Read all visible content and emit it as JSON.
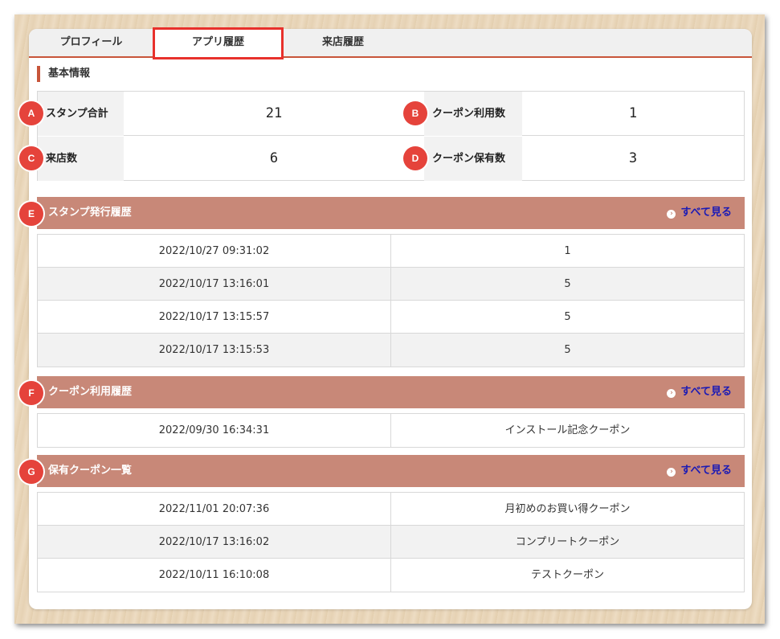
{
  "tabs": [
    {
      "label": "プロフィール"
    },
    {
      "label": "アプリ履歴",
      "active": true
    },
    {
      "label": "来店履歴"
    }
  ],
  "basic_info": {
    "title": "基本情報",
    "items": [
      {
        "badge": "A",
        "label": "スタンプ合計",
        "value": "21"
      },
      {
        "badge": "B",
        "label": "クーポン利用数",
        "value": "1"
      },
      {
        "badge": "C",
        "label": "来店数",
        "value": "6"
      },
      {
        "badge": "D",
        "label": "クーポン保有数",
        "value": "3"
      }
    ]
  },
  "see_all_label": "すべて見る",
  "stamp_history": {
    "badge": "E",
    "title": "スタンプ発行履歴",
    "rows": [
      {
        "datetime": "2022/10/27 09:31:02",
        "value": "1"
      },
      {
        "datetime": "2022/10/17 13:16:01",
        "value": "5"
      },
      {
        "datetime": "2022/10/17 13:15:57",
        "value": "5"
      },
      {
        "datetime": "2022/10/17 13:15:53",
        "value": "5"
      }
    ]
  },
  "coupon_usage": {
    "badge": "F",
    "title": "クーポン利用履歴",
    "rows": [
      {
        "datetime": "2022/09/30 16:34:31",
        "value": "インストール記念クーポン"
      }
    ]
  },
  "owned_coupons": {
    "badge": "G",
    "title": "保有クーポン一覧",
    "rows": [
      {
        "datetime": "2022/11/01 20:07:36",
        "value": "月初めのお買い得クーポン"
      },
      {
        "datetime": "2022/10/17 13:16:02",
        "value": "コンプリートクーポン"
      },
      {
        "datetime": "2022/10/11 16:10:08",
        "value": "テストクーポン"
      }
    ]
  },
  "colors": {
    "accent_red": "#e8312c",
    "tab_underline": "#c8553a",
    "section_header": "#c88878",
    "badge": "#e5433b",
    "link": "#1a1ab5"
  }
}
